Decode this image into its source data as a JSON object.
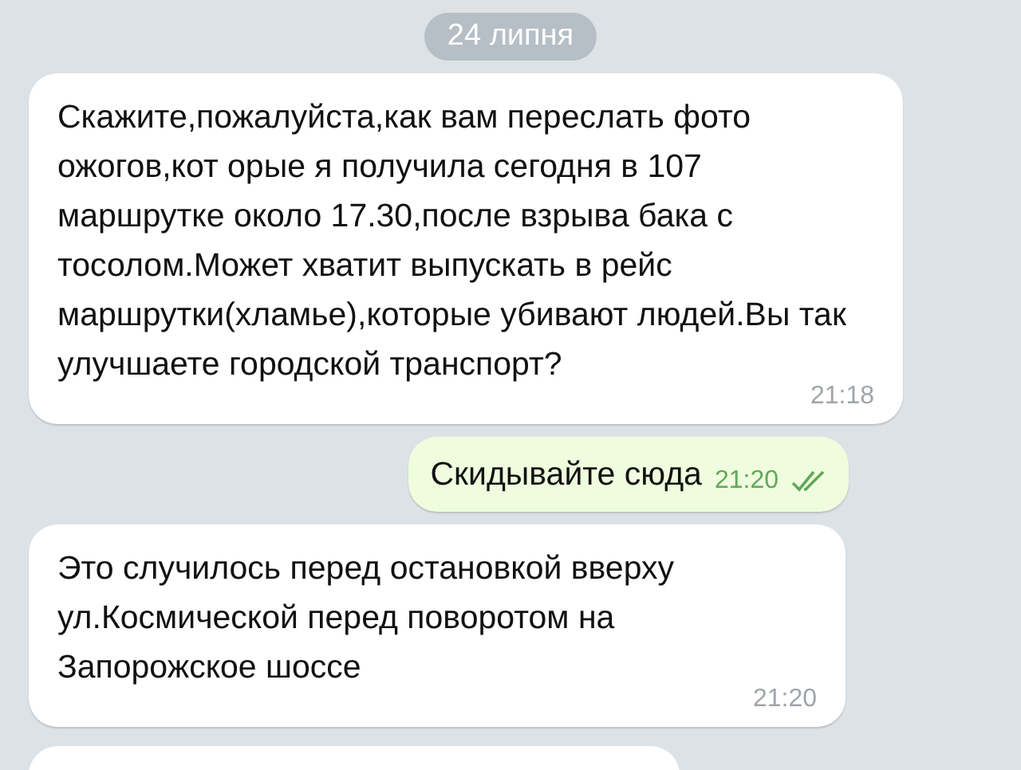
{
  "date_pill": "24 липня",
  "messages": [
    {
      "kind": "incoming",
      "text": "Скажите,пожалуйста,как вам переслать фото ожогов,кот орые я получила сегодня в 107 маршрутке около 17.30,после взрыва бака с тосолом.Может хватит выпускать в рейс маршрутки(хламье),которые убивают людей.Вы так улучшаете городской транспорт?",
      "time": "21:18"
    },
    {
      "kind": "outgoing",
      "text": "Скидывайте сюда",
      "time": "21:20",
      "read": true
    },
    {
      "kind": "incoming",
      "text": "Это случилось перед остановкой вверху ул.Космической перед поворотом на Запорожское шоссе",
      "time": "21:20"
    }
  ]
}
